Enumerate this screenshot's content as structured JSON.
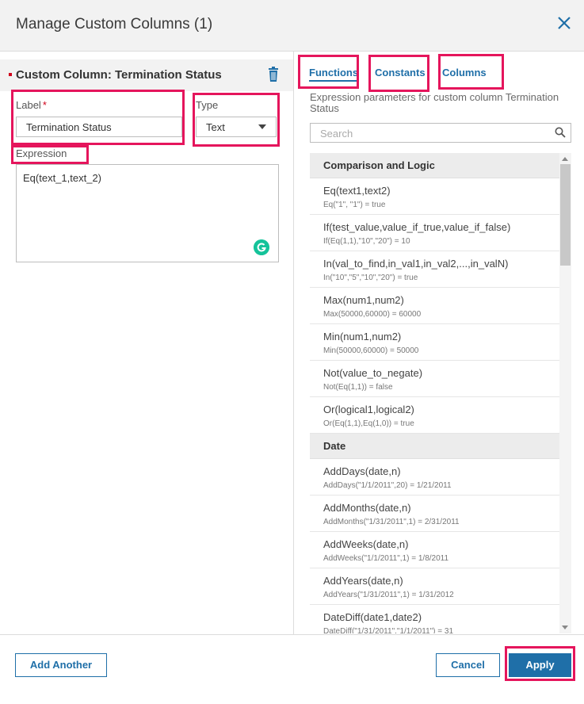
{
  "dialog": {
    "title": "Manage Custom Columns (1)",
    "close_icon": "close-x-icon",
    "accent_color": "#1f6fa8",
    "highlight_color": "#e5155c"
  },
  "left": {
    "custom_column_title": "Custom Column: Termination Status",
    "label_title": "Label",
    "label_required": "*",
    "label_value": "Termination Status",
    "type_title": "Type",
    "type_value": "Text",
    "expression_title": "Expression",
    "expression_value": "Eq(text_1,text_2)"
  },
  "right": {
    "tabs": [
      {
        "label": "Functions",
        "active": true
      },
      {
        "label": "Constants",
        "active": false
      },
      {
        "label": "Columns",
        "active": false
      }
    ],
    "hint": "Expression parameters for custom column Termination Status",
    "search_placeholder": "Search",
    "groups": [
      {
        "name": "Comparison and Logic",
        "items": [
          {
            "fn": "Eq(text1,text2)",
            "ex": "Eq(\"1\", \"1\") = true"
          },
          {
            "fn": "If(test_value,value_if_true,value_if_false)",
            "ex": "If(Eq(1,1),\"10\",\"20\") = 10"
          },
          {
            "fn": "In(val_to_find,in_val1,in_val2,...,in_valN)",
            "ex": "In(\"10\",\"5\",\"10\",\"20\") = true"
          },
          {
            "fn": "Max(num1,num2)",
            "ex": "Max(50000,60000) = 60000"
          },
          {
            "fn": "Min(num1,num2)",
            "ex": "Min(50000,60000) = 50000"
          },
          {
            "fn": "Not(value_to_negate)",
            "ex": "Not(Eq(1,1)) = false"
          },
          {
            "fn": "Or(logical1,logical2)",
            "ex": "Or(Eq(1,1),Eq(1,0)) = true"
          }
        ]
      },
      {
        "name": "Date",
        "items": [
          {
            "fn": "AddDays(date,n)",
            "ex": "AddDays(\"1/1/2011\",20) = 1/21/2011"
          },
          {
            "fn": "AddMonths(date,n)",
            "ex": "AddMonths(\"1/31/2011\",1) = 2/31/2011"
          },
          {
            "fn": "AddWeeks(date,n)",
            "ex": "AddWeeks(\"1/1/2011\",1) = 1/8/2011"
          },
          {
            "fn": "AddYears(date,n)",
            "ex": "AddYears(\"1/31/2011\",1) = 1/31/2012"
          },
          {
            "fn": "DateDiff(date1,date2)",
            "ex": "DateDiff(\"1/31/2011\",\"1/1/2011\") = 31"
          }
        ]
      }
    ]
  },
  "footer": {
    "add_another": "Add Another",
    "cancel": "Cancel",
    "apply": "Apply"
  }
}
